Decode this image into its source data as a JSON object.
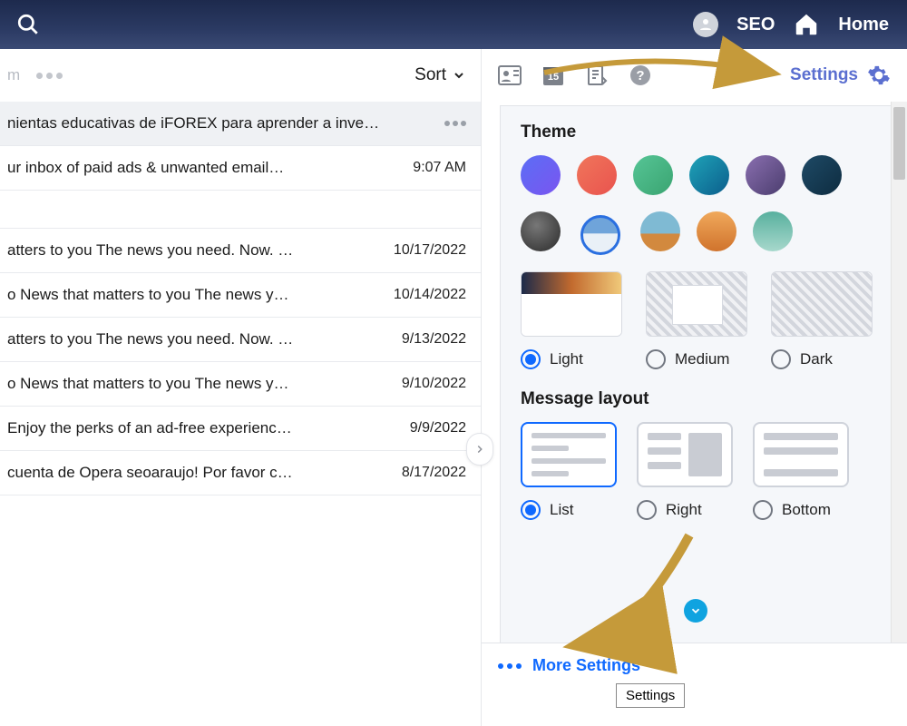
{
  "header": {
    "username": "SEO",
    "home_label": "Home"
  },
  "list": {
    "m_placeholder": "m",
    "sort_label": "Sort"
  },
  "messages": [
    {
      "subject": "nientas educativas de iFOREX para aprender a inve…",
      "time": "",
      "selected": true
    },
    {
      "subject": "ur inbox of paid ads & unwanted email…",
      "time": "9:07 AM",
      "selected": false
    },
    {
      "subject": "atters to you The news you need. Now. …",
      "time": "10/17/2022",
      "selected": false
    },
    {
      "subject": "o  News that matters to you The news y…",
      "time": "10/14/2022",
      "selected": false
    },
    {
      "subject": "atters to you The news you need. Now. …",
      "time": "9/13/2022",
      "selected": false
    },
    {
      "subject": "o  News that matters to you The news y…",
      "time": "9/10/2022",
      "selected": false
    },
    {
      "subject": "Enjoy the perks of an ad-free experienc…",
      "time": "9/9/2022",
      "selected": false
    },
    {
      "subject": "cuenta de Opera seoaraujo! Por favor c…",
      "time": "8/17/2022",
      "selected": false
    }
  ],
  "icons_row": {
    "calendar_day": "15",
    "settings_label": "Settings"
  },
  "panel": {
    "theme_heading": "Theme",
    "mode_light": "Light",
    "mode_medium": "Medium",
    "mode_dark": "Dark",
    "layout_heading": "Message layout",
    "layout_list": "List",
    "layout_right": "Right",
    "layout_bottom": "Bottom"
  },
  "footer": {
    "more_settings": "More Settings",
    "tooltip": "Settings"
  }
}
